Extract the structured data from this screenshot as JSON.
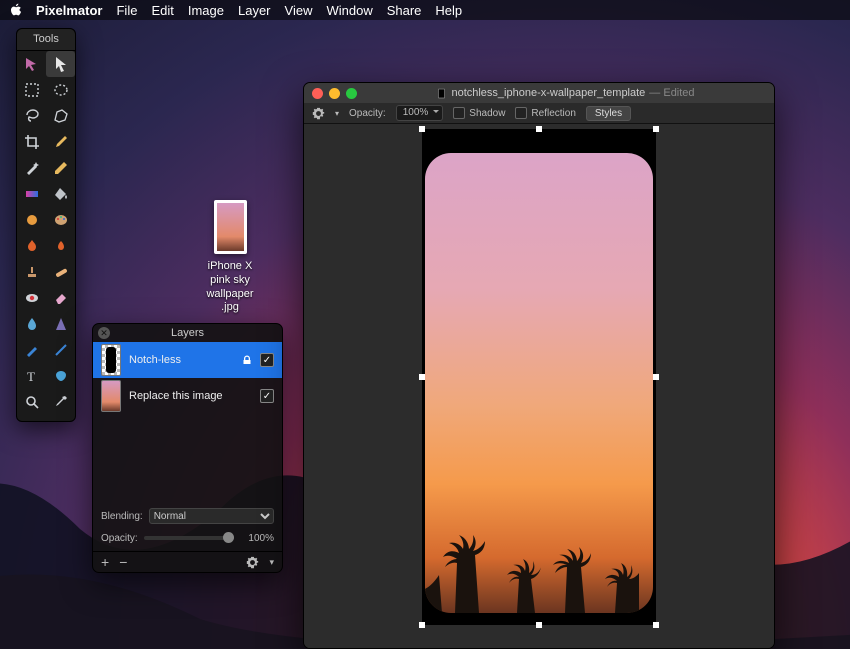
{
  "menubar": {
    "app": "Pixelmator",
    "items": [
      "File",
      "Edit",
      "Image",
      "Layer",
      "View",
      "Window",
      "Share",
      "Help"
    ]
  },
  "tools_panel": {
    "title": "Tools"
  },
  "desktop_file": {
    "name_line1": "iPhone X pink sky",
    "name_line2": "wallpaper .jpg"
  },
  "layers_panel": {
    "title": "Layers",
    "rows": [
      {
        "name": "Notch-less",
        "selected": true,
        "locked": true,
        "visible": true
      },
      {
        "name": "Replace this image",
        "selected": false,
        "locked": false,
        "visible": true
      }
    ],
    "blending_label": "Blending:",
    "blending_value": "Normal",
    "opacity_label": "Opacity:",
    "opacity_value": "100%"
  },
  "document": {
    "title": "notchless_iphone-x-wallpaper_template",
    "edited": "— Edited",
    "options": {
      "opacity_label": "Opacity:",
      "opacity_value": "100%",
      "shadow": "Shadow",
      "reflection": "Reflection",
      "styles": "Styles"
    }
  }
}
